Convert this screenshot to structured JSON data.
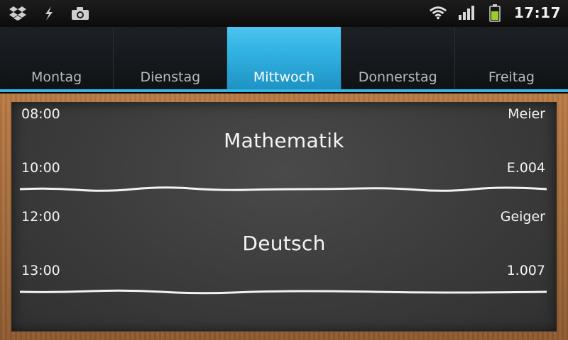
{
  "status_bar": {
    "icons": [
      "dropbox-icon",
      "usb-debug-icon",
      "camera-icon"
    ],
    "clock": "17:17",
    "battery_color": "#9ccc2a",
    "wifi": "wifi-icon",
    "signal": "signal-icon"
  },
  "tabs": [
    {
      "label": "Montag",
      "active": false
    },
    {
      "label": "Dienstag",
      "active": false
    },
    {
      "label": "Mittwoch",
      "active": true
    },
    {
      "label": "Donnerstag",
      "active": false
    },
    {
      "label": "Freitag",
      "active": false
    }
  ],
  "accent_color": "#33b5e5",
  "lessons": [
    {
      "start": "08:00",
      "end": "10:00",
      "subject": "Mathematik",
      "teacher": "Meier",
      "room": "E.004"
    },
    {
      "start": "12:00",
      "end": "13:00",
      "subject": "Deutsch",
      "teacher": "Geiger",
      "room": "1.007"
    }
  ]
}
